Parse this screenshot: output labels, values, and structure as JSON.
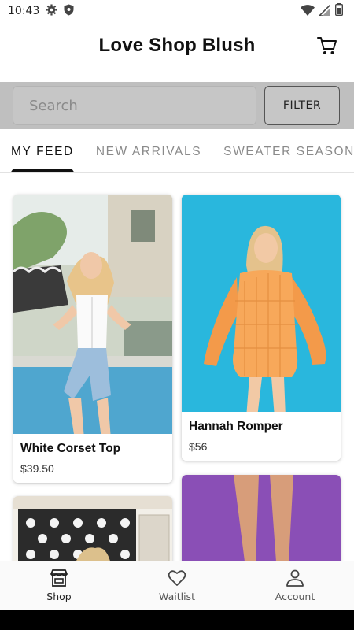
{
  "status_bar": {
    "time": "10:43",
    "icons": [
      "gear-icon",
      "shield-icon",
      "wifi-icon",
      "no-signal-icon",
      "battery-icon"
    ]
  },
  "header": {
    "title": "Love Shop Blush",
    "cart_icon": "cart-icon"
  },
  "search": {
    "placeholder": "Search",
    "value": "",
    "filter_label": "FILTER"
  },
  "tabs": [
    {
      "label": "MY FEED",
      "active": true
    },
    {
      "label": "NEW ARRIVALS",
      "active": false
    },
    {
      "label": "SWEATER SEASON",
      "active": false
    }
  ],
  "products": [
    {
      "name": "White Corset Top",
      "price": "$39.50",
      "image": "photo-woman-white-corset-denim-shorts"
    },
    {
      "name": "Hannah Romper",
      "price": "$56",
      "image": "photo-woman-orange-gingham-romper"
    },
    {
      "name": "",
      "price": "",
      "image": "photo-woman-black-white-patterned-wall"
    },
    {
      "name": "",
      "price": "",
      "image": "photo-legs-purple-background"
    }
  ],
  "bottom_nav": [
    {
      "label": "Shop",
      "icon": "storefront-icon",
      "active": true
    },
    {
      "label": "Waitlist",
      "icon": "heart-icon",
      "active": false
    },
    {
      "label": "Account",
      "icon": "person-icon",
      "active": false
    }
  ],
  "colors": {
    "search_band": "#bfbfbf",
    "tab_active": "#111111",
    "tab_inactive": "#8a8a8a",
    "romper_bg": "#29b7dd"
  }
}
